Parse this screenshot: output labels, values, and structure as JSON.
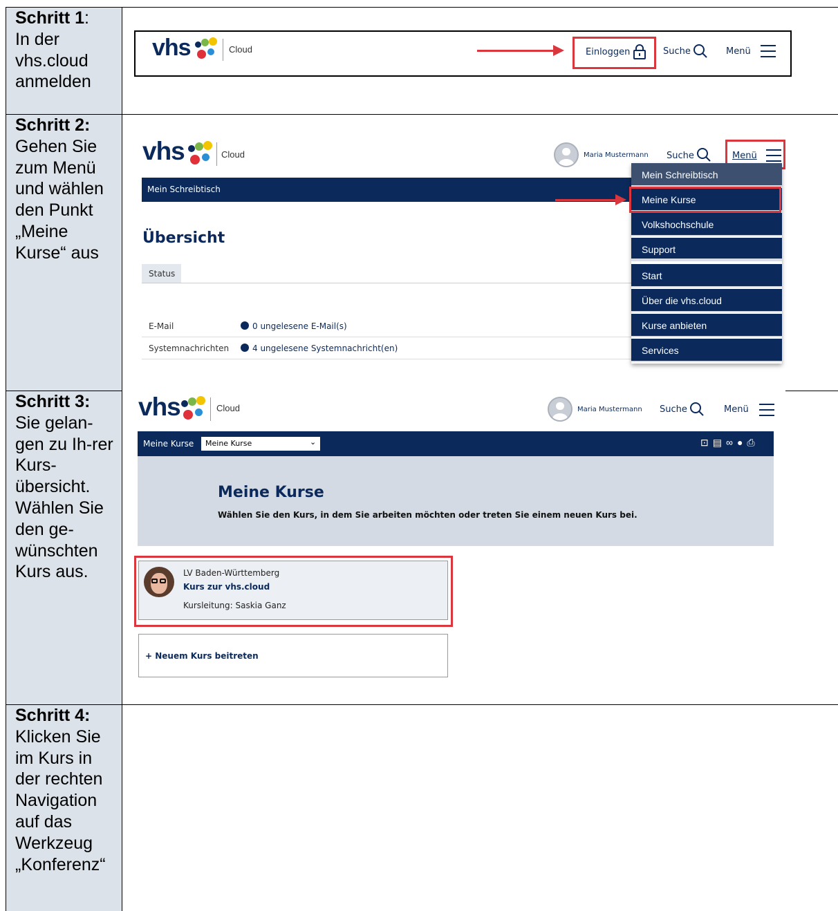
{
  "steps": [
    {
      "title": "Schritt 1",
      "title_suffix": ":",
      "text": "In der vhs.cloud anmelden"
    },
    {
      "title": "Schritt 2:",
      "text": "Gehen Sie zum Menü und wählen den Punkt „Meine Kurse“ aus"
    },
    {
      "title": "Schritt 3:",
      "text": "Sie gelan-gen zu Ih-rer Kurs-übersicht. Wählen Sie den ge-wünschten Kurs aus."
    },
    {
      "title": "Schritt 4:",
      "text": "Klicken Sie im Kurs in der rechten Navigation auf das Werkzeug „Konferenz“"
    }
  ],
  "brand": {
    "logo": "vhs",
    "product": "Cloud",
    "navy": "#0b2a5b",
    "highlight": "#d9363e"
  },
  "shot1": {
    "login": "Einloggen",
    "search": "Suche",
    "menu": "Menü"
  },
  "shot2": {
    "user": "Maria Mustermann",
    "search": "Suche",
    "menu": "Menü",
    "bar": "Mein Schreibtisch",
    "heading": "Übersicht",
    "tab": "Status",
    "rows": [
      {
        "label": "E-Mail",
        "value": "0 ungelesene E-Mail(s)"
      },
      {
        "label": "Systemnachrichten",
        "value": "4 ungelesene Systemnachricht(en)"
      }
    ],
    "dropdown": [
      "Mein Schreibtisch",
      "Meine Kurse",
      "Volkshochschule",
      "Support",
      "Start",
      "Über die vhs.cloud",
      "Kurse anbieten",
      "Services"
    ]
  },
  "shot3": {
    "user": "Maria Mustermann",
    "search": "Suche",
    "menu": "Menü",
    "bar_label": "Meine Kurse",
    "select_value": "Meine Kurse",
    "heading": "Meine Kurse",
    "subheading": "Wählen Sie den Kurs, in dem Sie arbeiten möchten oder treten Sie einem neuen Kurs bei.",
    "course": {
      "org": "LV Baden-Württemberg",
      "name": "Kurs zur vhs.cloud",
      "lead": "Kursleitung: Saskia Ganz"
    },
    "join": "+ Neuem Kurs beitreten"
  }
}
